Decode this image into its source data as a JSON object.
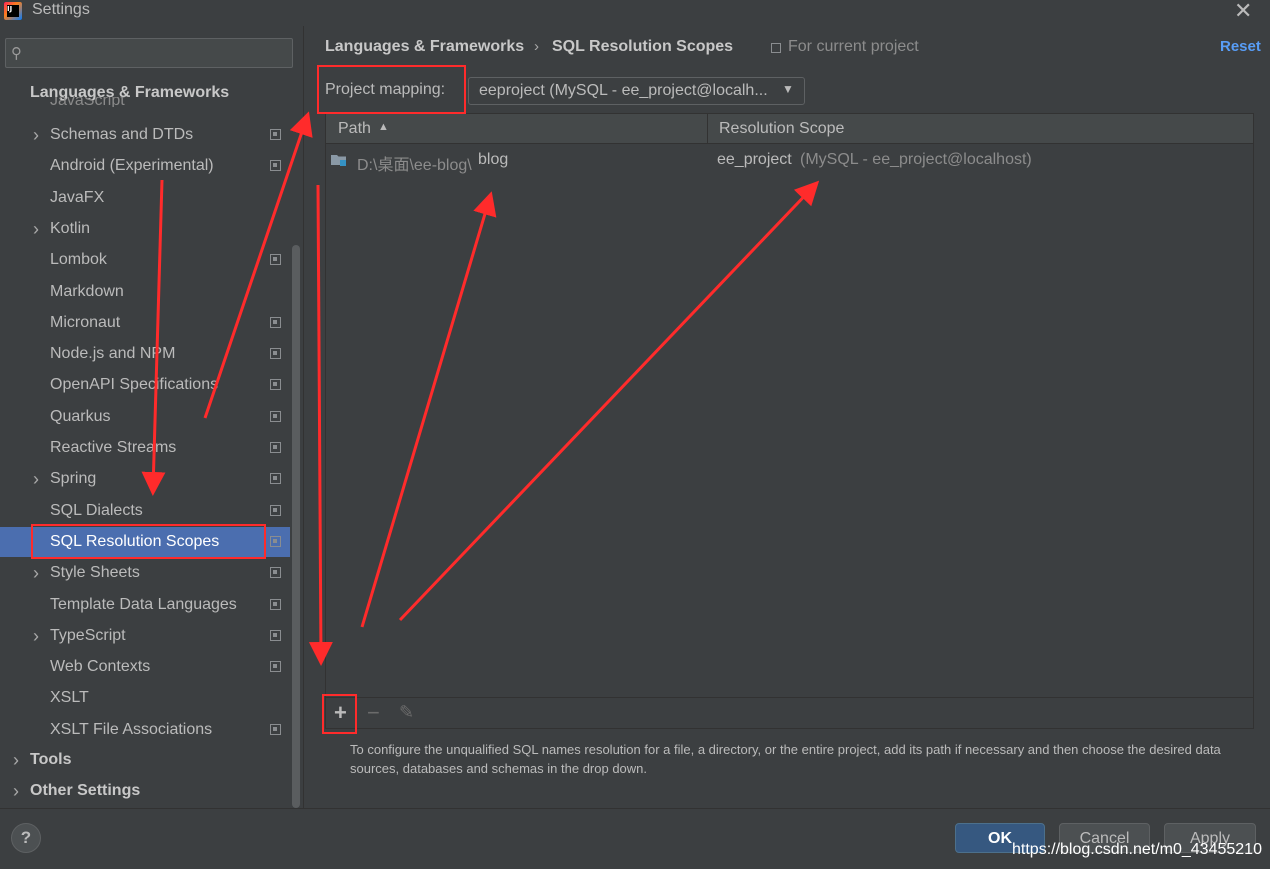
{
  "window": {
    "title": "Settings"
  },
  "sidebar": {
    "search_placeholder": "",
    "section_header": "Languages & Frameworks",
    "clipped_item": "JavaScript",
    "items": [
      {
        "label": "Schemas and DTDs",
        "expandable": true,
        "project": true
      },
      {
        "label": "Android (Experimental)",
        "expandable": false,
        "project": true
      },
      {
        "label": "JavaFX",
        "expandable": false,
        "project": false
      },
      {
        "label": "Kotlin",
        "expandable": true,
        "project": false
      },
      {
        "label": "Lombok",
        "expandable": false,
        "project": true
      },
      {
        "label": "Markdown",
        "expandable": false,
        "project": false
      },
      {
        "label": "Micronaut",
        "expandable": false,
        "project": true
      },
      {
        "label": "Node.js and NPM",
        "expandable": false,
        "project": true
      },
      {
        "label": "OpenAPI Specifications",
        "expandable": false,
        "project": true
      },
      {
        "label": "Quarkus",
        "expandable": false,
        "project": true
      },
      {
        "label": "Reactive Streams",
        "expandable": false,
        "project": true
      },
      {
        "label": "Spring",
        "expandable": true,
        "project": true
      },
      {
        "label": "SQL Dialects",
        "expandable": false,
        "project": true
      },
      {
        "label": "SQL Resolution Scopes",
        "expandable": false,
        "project": true,
        "selected": true
      },
      {
        "label": "Style Sheets",
        "expandable": true,
        "project": true
      },
      {
        "label": "Template Data Languages",
        "expandable": false,
        "project": true
      },
      {
        "label": "TypeScript",
        "expandable": true,
        "project": true
      },
      {
        "label": "Web Contexts",
        "expandable": false,
        "project": true
      },
      {
        "label": "XSLT",
        "expandable": false,
        "project": false
      },
      {
        "label": "XSLT File Associations",
        "expandable": false,
        "project": true
      }
    ],
    "top_level": [
      {
        "label": "Tools"
      },
      {
        "label": "Other Settings"
      }
    ]
  },
  "header": {
    "breadcrumb_parent": "Languages & Frameworks",
    "breadcrumb_separator": "›",
    "breadcrumb_current": "SQL Resolution Scopes",
    "scope_note": "For current project",
    "reset": "Reset"
  },
  "mapping": {
    "label": "Project mapping:",
    "value": "eeproject (MySQL - ee_project@localh..."
  },
  "table": {
    "columns": [
      "Path",
      "Resolution Scope"
    ],
    "sort_indicator": "▲",
    "rows": [
      {
        "path_prefix": "D:\\桌面\\ee-blog\\",
        "path_name": "blog",
        "scope_name": "ee_project",
        "scope_detail": "(MySQL - ee_project@localhost)"
      }
    ]
  },
  "toolbar": {
    "add": "+",
    "remove": "−",
    "edit": "✎"
  },
  "help_text": "To configure the unqualified SQL names resolution for a file, a directory, or the entire project, add its path if necessary and then choose the desired data sources, databases and schemas in the drop down.",
  "footer": {
    "help": "?",
    "ok": "OK",
    "cancel": "Cancel",
    "apply": "Apply",
    "watermark": "https://blog.csdn.net/m0_43455210"
  },
  "colors": {
    "background": "#3c3f41",
    "selection": "#4b6eaf",
    "link": "#589df6",
    "primary_button": "#365880",
    "annotation": "#ff2b2b"
  }
}
